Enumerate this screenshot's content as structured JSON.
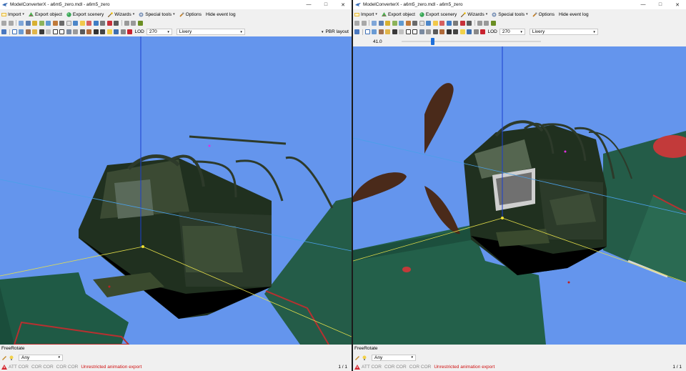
{
  "windows": {
    "left": {
      "title": "ModelConverterX - a6m5_zero.mdl - a6m5_zero",
      "lod_label": "LOD",
      "lod_value": "270",
      "livery_label": "Livery",
      "pbr_label": "PBR layout",
      "status_title": "FreeRotate",
      "filter_value": "Any",
      "status_tags": [
        "ATT COR",
        "COR COR",
        "COR COR"
      ],
      "status_message": "Unrestricted animation export",
      "page_count": "1 / 1"
    },
    "right": {
      "title": "ModelConverterX - a6m5_zero.mdl - a6m5_zero",
      "lod_label": "LOD",
      "lod_value": "270",
      "livery_label": "Livery",
      "slider_value": "41.0",
      "slider_fraction": 0.22,
      "status_title": "FreeRotate",
      "filter_value": "Any",
      "status_tags": [
        "ATT COR",
        "COR COR",
        "COR COR"
      ],
      "status_message": "Unrestricted animation export",
      "page_count": "1 / 1"
    }
  },
  "menu": {
    "import": "Import",
    "export_object": "Export object",
    "export_scenery": "Export scenery",
    "wizards": "Wizards",
    "special_tools": "Special tools",
    "options": "Options",
    "hide_event_log": "Hide event log"
  },
  "icons": {
    "window_controls": [
      "minimize-icon",
      "maximize-icon",
      "close-icon"
    ],
    "menu": [
      "import-icon",
      "export-object-icon",
      "export-scenery-icon",
      "wizard-icon",
      "special-tools-icon",
      "options-icon"
    ],
    "status": [
      "warning-icon",
      "pencil-icon",
      "lightbulb-icon"
    ]
  },
  "colors": {
    "viewport_background": "#6495ED",
    "status_message": "#D01010",
    "slider_thumb": "#1E6FD9"
  }
}
